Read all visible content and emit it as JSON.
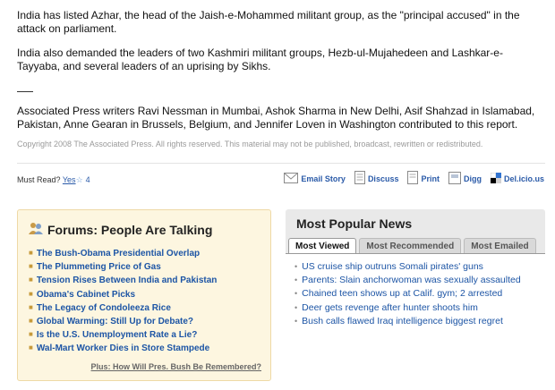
{
  "article": {
    "p1": "India has listed Azhar, the head of the Jaish-e-Mohammed militant group, as the \"principal accused\" in the attack on parliament.",
    "p2": "India also demanded the leaders of two Kashmiri militant groups, Hezb-ul-Mujahedeen and Lashkar-e-Tayyaba, and several leaders of an uprising by Sikhs.",
    "p3": "Associated Press writers Ravi Nessman in Mumbai, Ashok Sharma in New Delhi, Asif Shahzad in Islamabad, Pakistan, Anne Gearan in Brussels, Belgium, and Jennifer Loven in Washington contributed to this report.",
    "copyright": "Copyright 2008 The Associated Press. All rights reserved. This material may not be published, broadcast, rewritten or redistributed."
  },
  "must_read": {
    "label": "Must Read?",
    "yes": "Yes",
    "count": "4"
  },
  "tools": [
    {
      "label": "Email Story",
      "icon": "envelope-icon"
    },
    {
      "label": "Discuss",
      "icon": "discuss-icon"
    },
    {
      "label": "Print",
      "icon": "print-icon"
    },
    {
      "label": "Digg",
      "icon": "digg-icon"
    },
    {
      "label": "Del.icio.us",
      "icon": "delicious-icon"
    }
  ],
  "forums": {
    "title": "Forums: People Are Talking",
    "items": [
      "The Bush-Obama Presidential Overlap",
      "The Plummeting Price of Gas",
      "Tension Rises Between India and Pakistan",
      "Obama's Cabinet Picks",
      "The Legacy of Condoleeza Rice",
      "Global Warming: Still Up for Debate?",
      "Is the U.S. Unemployment Rate a Lie?",
      "Wal-Mart Worker Dies in Store Stampede"
    ],
    "plus": "Plus: How Will Pres. Bush Be Remembered?"
  },
  "popular": {
    "title": "Most Popular News",
    "tabs": [
      "Most Viewed",
      "Most Recommended",
      "Most Emailed"
    ],
    "items": [
      "US cruise ship outruns Somali pirates' guns",
      "Parents: Slain anchorwoman was sexually assaulted",
      "Chained teen shows up at Calif. gym; 2 arrested",
      "Deer gets revenge after hunter shoots him",
      "Bush calls flawed Iraq intelligence biggest regret"
    ]
  }
}
